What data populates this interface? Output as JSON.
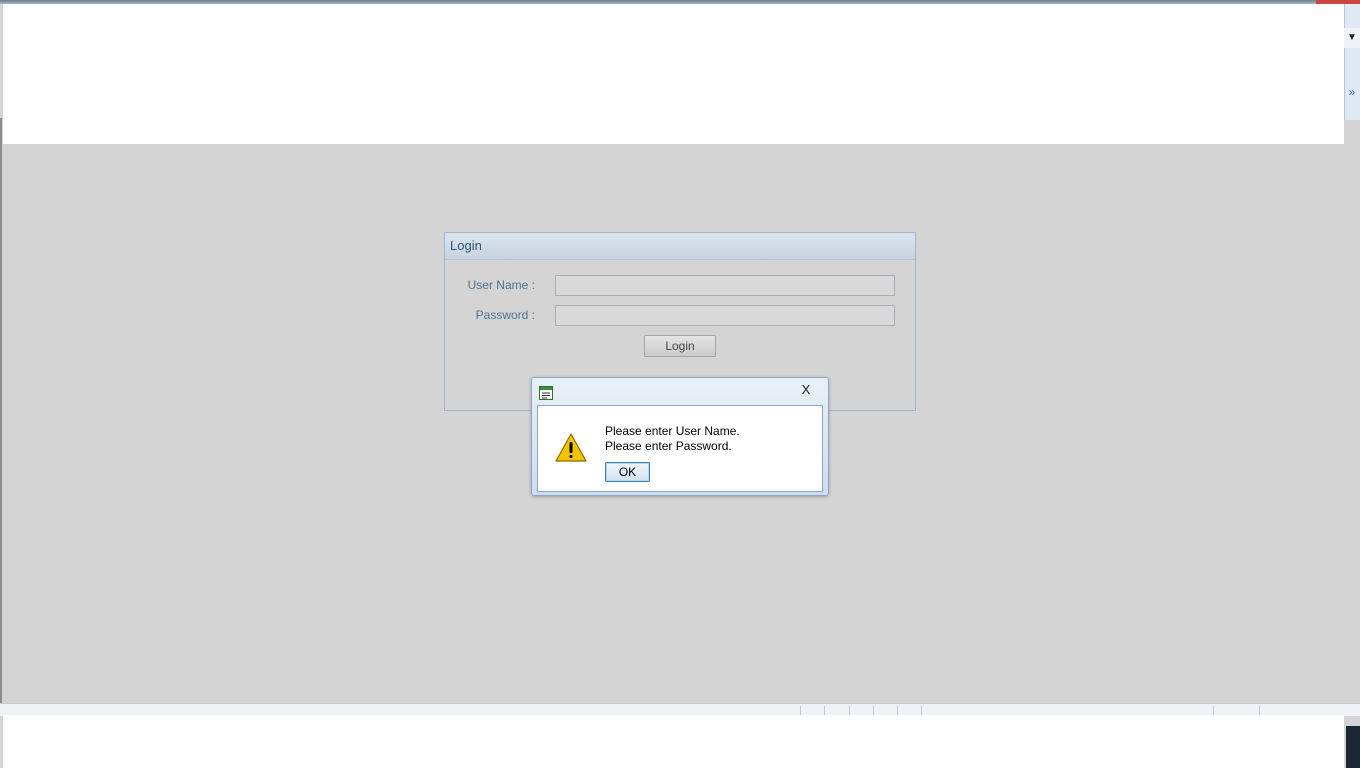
{
  "login": {
    "title": "Login",
    "username_label": "User Name :",
    "username_value": "",
    "password_label": "Password :",
    "password_value": "",
    "submit_label": "Login"
  },
  "dialog": {
    "app_icon": "window-icon",
    "close_label": "X",
    "warning_icon": "warning-icon",
    "message_line1": "Please enter User Name.",
    "message_line2": "Please enter Password.",
    "ok_label": "OK"
  },
  "chrome": {
    "dropdown_glyph": "▼",
    "chevron_glyph": "»"
  },
  "colors": {
    "page_background": "#d4d4d4",
    "panel_header_text": "#2f5577",
    "label_text": "#4f7291",
    "dialog_border": "#8aa6c6",
    "warning_yellow": "#f5c400"
  }
}
